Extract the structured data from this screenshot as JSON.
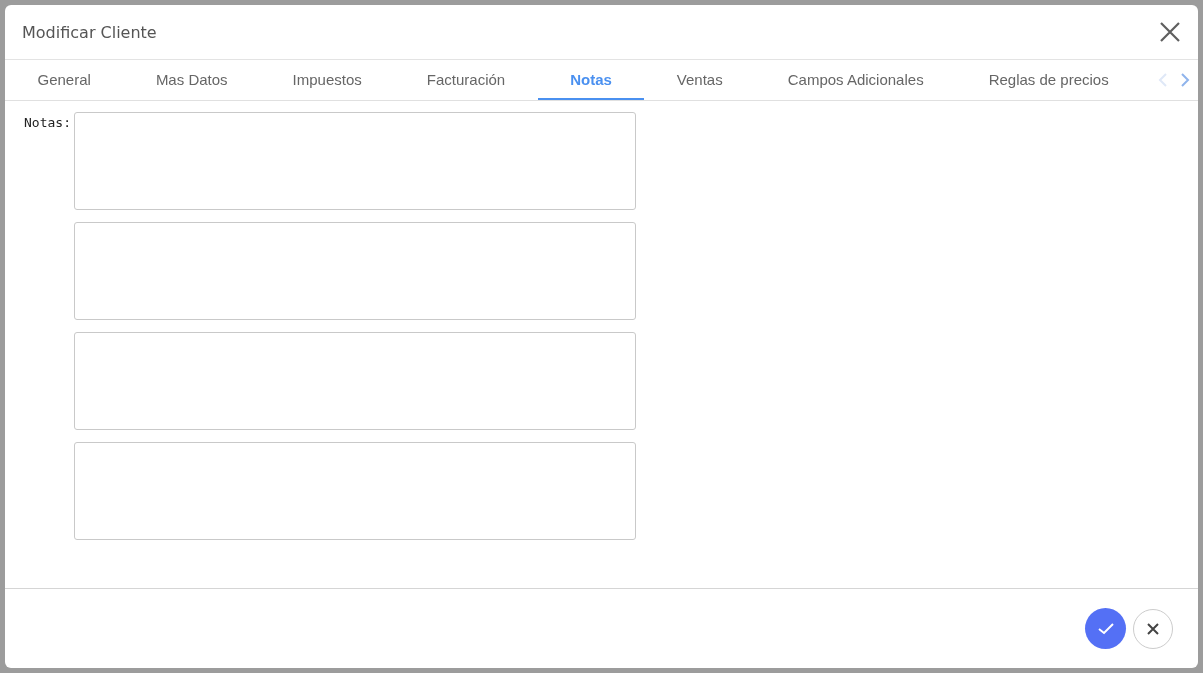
{
  "dialog": {
    "title": "Modificar Cliente"
  },
  "tabs": [
    {
      "label": "General",
      "selected": false
    },
    {
      "label": "Mas Datos",
      "selected": false
    },
    {
      "label": "Impuestos",
      "selected": false
    },
    {
      "label": "Facturación",
      "selected": false
    },
    {
      "label": "Notas",
      "selected": true
    },
    {
      "label": "Ventas",
      "selected": false
    },
    {
      "label": "Campos Adicionales",
      "selected": false
    },
    {
      "label": "Reglas de precios",
      "selected": false
    }
  ],
  "notes": {
    "label": "Notas:",
    "fields": [
      {
        "kind": "textarea"
      },
      {
        "kind": "textarea"
      },
      {
        "kind": "textarea"
      },
      {
        "kind": "textarea"
      }
    ]
  }
}
